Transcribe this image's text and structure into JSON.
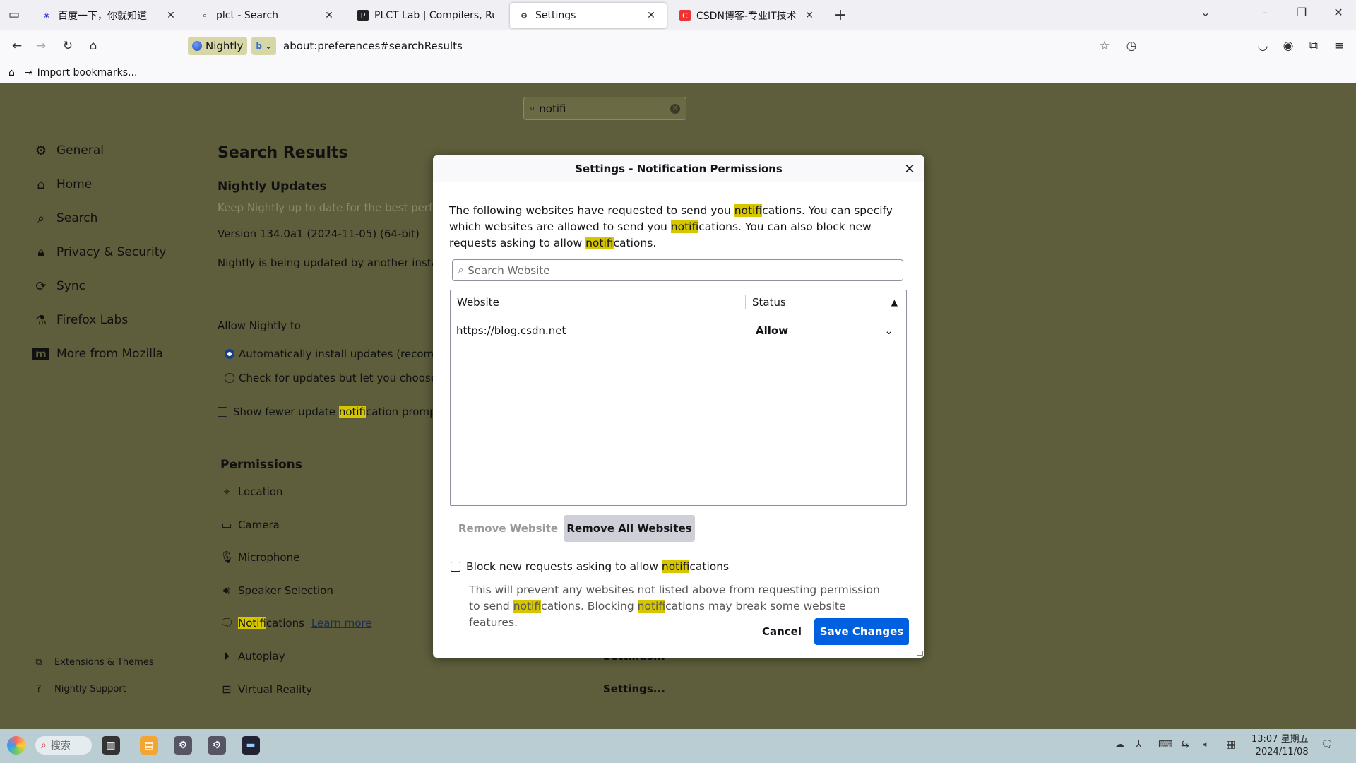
{
  "tabs": [
    {
      "title": "百度一下，你就知道",
      "favicon": "baidu-paw-icon",
      "active": false
    },
    {
      "title": "plct - Search",
      "favicon": "search-icon",
      "active": false
    },
    {
      "title": "PLCT Lab | Compilers, Runti",
      "favicon": "plct-p-icon",
      "active": false
    },
    {
      "title": "Settings",
      "favicon": "gear-icon",
      "active": true
    },
    {
      "title": "CSDN博客-专业IT技术发表",
      "favicon": "csdn-c-icon",
      "active": false
    }
  ],
  "navbar": {
    "identity_label": "Nightly",
    "url": "about:preferences#searchResults"
  },
  "bookmarks": {
    "import_label": "Import bookmarks..."
  },
  "prefs_search": {
    "value": "notifi"
  },
  "sidebar": {
    "items": [
      {
        "label": "General",
        "icon": "gear-icon"
      },
      {
        "label": "Home",
        "icon": "home-icon"
      },
      {
        "label": "Search",
        "icon": "search-icon"
      },
      {
        "label": "Privacy & Security",
        "icon": "lock-icon"
      },
      {
        "label": "Sync",
        "icon": "sync-icon"
      },
      {
        "label": "Firefox Labs",
        "icon": "labs-icon"
      },
      {
        "label": "More from Mozilla",
        "icon": "mozilla-m-icon"
      }
    ],
    "footer": [
      {
        "label": "Extensions & Themes",
        "icon": "puzzle-icon"
      },
      {
        "label": "Nightly Support",
        "icon": "help-icon"
      }
    ]
  },
  "main": {
    "heading": "Search Results",
    "updates_heading": "Nightly Updates",
    "updates_desc": "Keep Nightly up to date for the best performance",
    "version": "Version 134.0a1 (2024-11-05) (64-bit)",
    "updating_note": "Nightly is being updated by another instance",
    "allow_label": "Allow Nightly to",
    "radio_auto": "Automatically install updates (recommended)",
    "radio_check": "Check for updates but let you choose to install them",
    "fewer_prompts_pre": "Show fewer update ",
    "fewer_prompts_hl": "notifi",
    "fewer_prompts_post": "cation prompts",
    "permissions_heading": "Permissions",
    "permissions": [
      {
        "label": "Location",
        "icon": "location-pin-icon"
      },
      {
        "label": "Camera",
        "icon": "camera-icon"
      },
      {
        "label": "Microphone",
        "icon": "microphone-icon"
      },
      {
        "label": "Speaker Selection",
        "icon": "speaker-icon"
      },
      {
        "label": "Autoplay",
        "icon": "autoplay-icon"
      },
      {
        "label": "Virtual Reality",
        "icon": "vr-headset-icon"
      }
    ],
    "notifications_hl": "Notifi",
    "notifications_rest": "cations",
    "learn_more": "Learn more",
    "settings_btn": "Settings..."
  },
  "dialog": {
    "title": "Settings - Notification Permissions",
    "desc_1": "The following websites have requested to send you ",
    "desc_hl1": "notifi",
    "desc_2": "cations. You can specify which websites are allowed to send you ",
    "desc_hl2": "notifi",
    "desc_3": "cations. You can also block new requests asking to allow ",
    "desc_hl3": "notifi",
    "desc_4": "cations.",
    "search_placeholder": "Search Website",
    "col_website": "Website",
    "col_status": "Status",
    "rows": [
      {
        "website": "https://blog.csdn.net",
        "status": "Allow"
      }
    ],
    "remove_website": "Remove Website",
    "remove_all": "Remove All Websites",
    "block_pre": "Block new requests asking to allow ",
    "block_hl": "notifi",
    "block_post": "cations",
    "note_1": "This will prevent any websites not listed above from requesting permission to send ",
    "note_hl1": "notifi",
    "note_2": "cations. Blocking ",
    "note_hl2": "notifi",
    "note_3": "cations may break some website features.",
    "cancel": "Cancel",
    "save": "Save Changes"
  },
  "taskbar": {
    "search_label": "搜索",
    "time": "13:07 星期五",
    "date": "2024/11/08"
  }
}
